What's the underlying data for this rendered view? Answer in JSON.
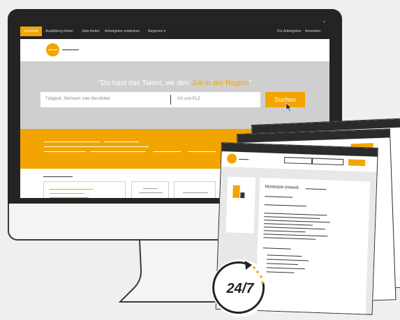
{
  "nav": {
    "items": [
      "Startseite",
      "Ausbildung finden",
      "Jobs finden",
      "Arbeitgeber entdecken",
      "Regionen"
    ],
    "right_items": [
      "Für Arbeitgeber",
      "Anmelden"
    ],
    "close": "×"
  },
  "hero": {
    "headline_pre": "\"Du hast das Talent, wir den ",
    "headline_highlight": "Job in der Region",
    "headline_post": "\""
  },
  "search": {
    "keyword_placeholder": "Tätigkeit, Stichwort oder Berufstitel",
    "location_placeholder": "Ort und PLZ",
    "button_label": "Suchen"
  },
  "job_page": {
    "title": "Musterjob (m/w/d)"
  },
  "badge": {
    "label": "24/7"
  },
  "colors": {
    "accent": "#f2a500",
    "dark": "#232323",
    "hero_gray": "#cfcfcf"
  }
}
